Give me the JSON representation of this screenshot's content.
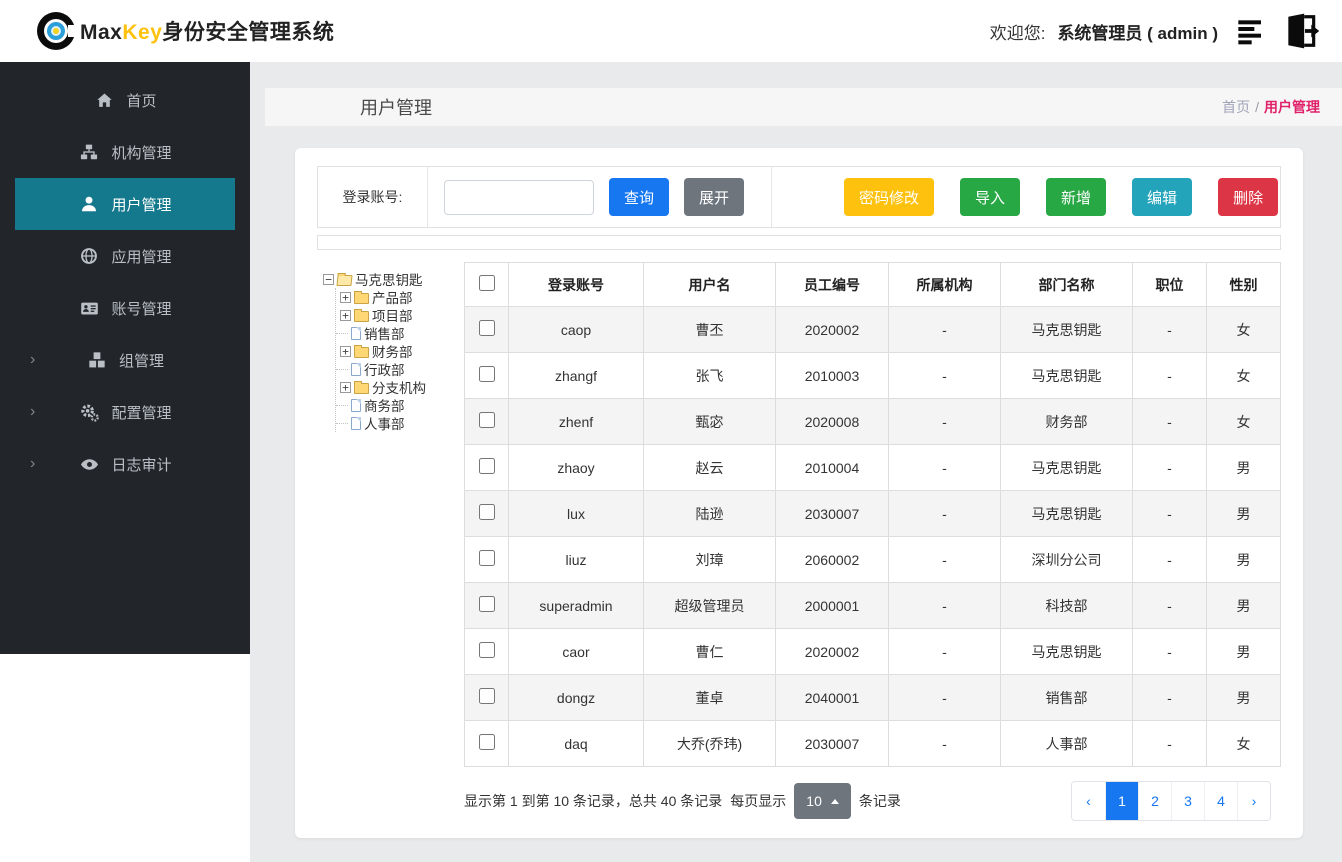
{
  "header": {
    "brand": {
      "max": "Max",
      "key": "Key",
      "suffix": "身份安全管理系统"
    },
    "welcome_label": "欢迎您:",
    "user_display": "系统管理员 ( admin )"
  },
  "sidebar": {
    "items": [
      {
        "label": "首页",
        "icon": "home-icon",
        "active": false,
        "chevron": false
      },
      {
        "label": "机构管理",
        "icon": "sitemap-icon",
        "active": false,
        "chevron": false
      },
      {
        "label": "用户管理",
        "icon": "user-icon",
        "active": true,
        "chevron": false
      },
      {
        "label": "应用管理",
        "icon": "globe-icon",
        "active": false,
        "chevron": false
      },
      {
        "label": "账号管理",
        "icon": "id-card-icon",
        "active": false,
        "chevron": false
      },
      {
        "label": "组管理",
        "icon": "cubes-icon",
        "active": false,
        "chevron": true
      },
      {
        "label": "配置管理",
        "icon": "gears-icon",
        "active": false,
        "chevron": true
      },
      {
        "label": "日志审计",
        "icon": "eye-icon",
        "active": false,
        "chevron": true
      }
    ]
  },
  "page": {
    "title": "用户管理",
    "breadcrumb": {
      "home": "首页",
      "separator": "/",
      "current": "用户管理"
    }
  },
  "search": {
    "field_label": "登录账号:",
    "input_value": "",
    "query_label": "查询",
    "expand_label": "展开",
    "actions": [
      {
        "label": "密码修改",
        "color": "#fec10d"
      },
      {
        "label": "导入",
        "color": "#28a745"
      },
      {
        "label": "新增",
        "color": "#28a745"
      },
      {
        "label": "编辑",
        "color": "#23a4bb"
      },
      {
        "label": "删除",
        "color": "#dc3545"
      }
    ]
  },
  "tree": {
    "nodes": [
      {
        "label": "马克思钥匙",
        "level": 0,
        "expander": "-",
        "icon": "folder-open"
      },
      {
        "label": "产品部",
        "level": 1,
        "expander": "+",
        "icon": "folder"
      },
      {
        "label": "项目部",
        "level": 1,
        "expander": "+",
        "icon": "folder"
      },
      {
        "label": "销售部",
        "level": 1,
        "expander": "",
        "icon": "file"
      },
      {
        "label": "财务部",
        "level": 1,
        "expander": "+",
        "icon": "folder"
      },
      {
        "label": "行政部",
        "level": 1,
        "expander": "",
        "icon": "file"
      },
      {
        "label": "分支机构",
        "level": 1,
        "expander": "+",
        "icon": "folder"
      },
      {
        "label": "商务部",
        "level": 1,
        "expander": "",
        "icon": "file"
      },
      {
        "label": "人事部",
        "level": 1,
        "expander": "",
        "icon": "file"
      }
    ]
  },
  "table": {
    "headers": [
      "登录账号",
      "用户名",
      "员工编号",
      "所属机构",
      "部门名称",
      "职位",
      "性别"
    ],
    "rows": [
      [
        "caop",
        "曹丕",
        "2020002",
        "-",
        "马克思钥匙",
        "-",
        "女"
      ],
      [
        "zhangf",
        "张飞",
        "2010003",
        "-",
        "马克思钥匙",
        "-",
        "女"
      ],
      [
        "zhenf",
        "甄宓",
        "2020008",
        "-",
        "财务部",
        "-",
        "女"
      ],
      [
        "zhaoy",
        "赵云",
        "2010004",
        "-",
        "马克思钥匙",
        "-",
        "男"
      ],
      [
        "lux",
        "陆逊",
        "2030007",
        "-",
        "马克思钥匙",
        "-",
        "男"
      ],
      [
        "liuz",
        "刘璋",
        "2060002",
        "-",
        "深圳分公司",
        "-",
        "男"
      ],
      [
        "superadmin",
        "超级管理员",
        "2000001",
        "-",
        "科技部",
        "-",
        "男"
      ],
      [
        "caor",
        "曹仁",
        "2020002",
        "-",
        "马克思钥匙",
        "-",
        "男"
      ],
      [
        "dongz",
        "董卓",
        "2040001",
        "-",
        "销售部",
        "-",
        "男"
      ],
      [
        "daq",
        "大乔(乔玮)",
        "2030007",
        "-",
        "人事部",
        "-",
        "女"
      ]
    ]
  },
  "footer": {
    "summary": "显示第 1 到第 10 条记录，总共 40 条记录",
    "per_page_label": "每页显示",
    "page_size": "10",
    "records_label": "条记录",
    "prev": "‹",
    "next": "›",
    "pages": [
      "1",
      "2",
      "3",
      "4"
    ],
    "active_page": "1",
    "accent_color": "#1677f0"
  }
}
